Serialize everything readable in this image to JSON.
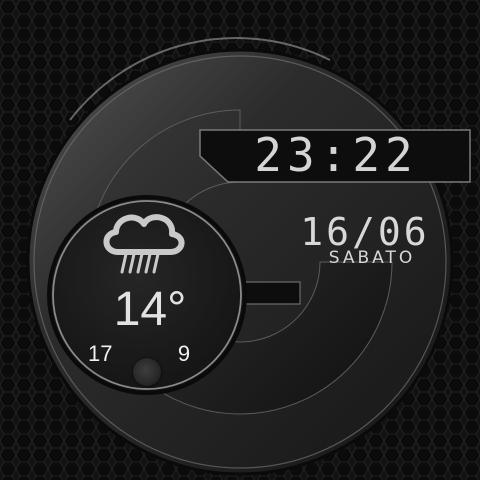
{
  "watchface": {
    "time": "23:22",
    "date": "16/06",
    "day": "SABATO",
    "weather": {
      "icon": "rain-cloud-icon",
      "temperature": "14°",
      "high": "17",
      "low": "9"
    }
  },
  "colors": {
    "background": "#141414",
    "ring_dark": "#1a1a1a",
    "ring_highlight": "#7a7a7a",
    "text": "#d4d4d4"
  }
}
